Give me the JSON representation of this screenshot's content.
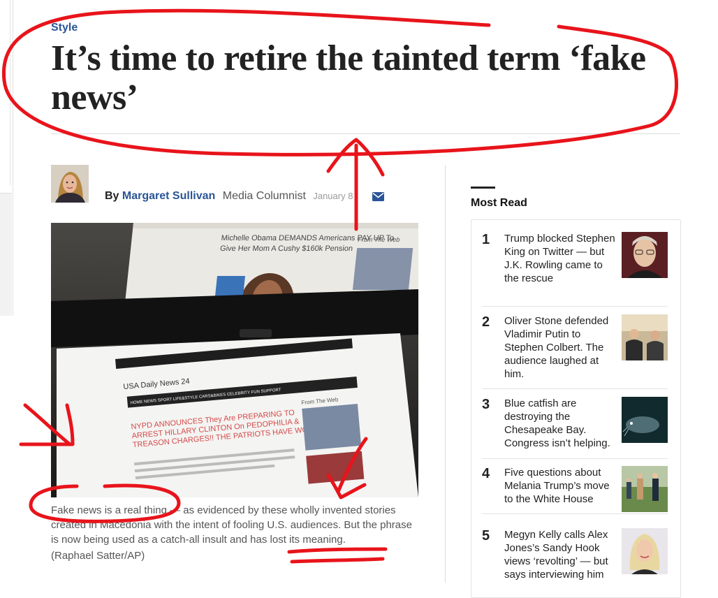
{
  "article": {
    "kicker": "Style",
    "headline": "It’s time to retire the tainted term ‘fake news’",
    "byline": {
      "by": "By",
      "author": "Margaret Sullivan",
      "role": "Media Columnist",
      "date": "January 8"
    },
    "photo": {
      "top_screen_headline": "Michelle Obama DEMANDS Americans PAY UP To Give Her Mom A Cushy $160k Pension",
      "top_screen_sidebar": "From The Web",
      "bottom_screen_site": "USA Daily News 24",
      "bottom_screen_nav": [
        "HOME",
        "NEWS",
        "SPORT",
        "LIFE&STYLE",
        "CARS&BIKES",
        "CELEBRITY",
        "FUN",
        "SUPPORT"
      ],
      "bottom_screen_headline": "NYPD ANNOUNCES They Are PREPARING TO ARREST HILLARY CLINTON On PEDOPHILIA & TREASON CHARGES!! THE PATRIOTS HAVE WON!!",
      "bottom_screen_sidebar": "From The Web"
    },
    "caption": "Fake news is a real thing — as evidenced by these wholly invented stories created in Macedonia with the intent of fooling U.S. audiences. But the phrase is now being used as a catch-all insult and has lost its meaning.",
    "credit": "(Raphael Satter/AP)"
  },
  "most_read": {
    "title": "Most Read",
    "items": [
      {
        "rank": "1",
        "text": "Trump blocked Stephen King on Twitter — but J.K. Rowling came to the rescue",
        "thumb_icon": "stephen-king-photo"
      },
      {
        "rank": "2",
        "text": "Oliver Stone defended Vladimir Putin to Stephen Colbert. The audience laughed at him.",
        "thumb_icon": "oliver-stone-putin-photo"
      },
      {
        "rank": "3",
        "text": "Blue catfish are destroying the Chesapeake Bay. Congress isn’t helping.",
        "thumb_icon": "blue-catfish-photo"
      },
      {
        "rank": "4",
        "text": "Five questions about Melania Trump’s move to the White House",
        "thumb_icon": "melania-trump-photo"
      },
      {
        "rank": "5",
        "text": "Megyn Kelly calls Alex Jones’s Sandy Hook views ‘revolting’ — but says interviewing him",
        "thumb_icon": "megyn-kelly-photo"
      }
    ]
  },
  "colors": {
    "accent_blue": "#2a5597",
    "annotation_red": "#e8141b"
  }
}
